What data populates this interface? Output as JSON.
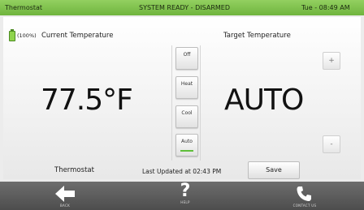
{
  "header": {
    "title": "Thermostat",
    "status": "SYSTEM READY - DISARMED",
    "datetime": "Tue - 08:49 AM"
  },
  "current": {
    "battery": "(100%)",
    "label": "Current Temperature",
    "value": "77.5°F"
  },
  "target": {
    "label": "Target Temperature",
    "value": "AUTO",
    "plus_label": "+",
    "minus_label": "-"
  },
  "modes": [
    {
      "label": "Off",
      "selected": false
    },
    {
      "label": "Heat",
      "selected": false
    },
    {
      "label": "Cool",
      "selected": false
    },
    {
      "label": "Auto",
      "selected": true
    }
  ],
  "footer": {
    "device_name": "Thermostat",
    "last_updated": "Last Updated at 02:43 PM",
    "save_label": "Save"
  },
  "nav": [
    {
      "label": "BACK",
      "icon": "arrow-left-icon"
    },
    {
      "label": "HELP",
      "icon": "question-icon"
    },
    {
      "label": "CONTACT US",
      "icon": "phone-icon"
    }
  ],
  "colors": {
    "accent": "#7cc24a",
    "selected_bar": "#5fbf3a",
    "nav_bg": "#555555"
  }
}
